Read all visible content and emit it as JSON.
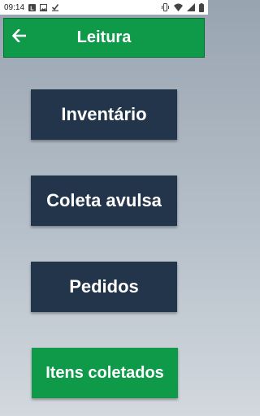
{
  "status_bar": {
    "time": "09:14",
    "left_icons": [
      "notification-l-icon",
      "image-icon",
      "download-done-icon"
    ],
    "right_icons": [
      "vibrate-icon",
      "wifi-icon",
      "signal-icon",
      "battery-icon"
    ]
  },
  "app_bar": {
    "title": "Leitura",
    "back_icon": "arrow-back-icon",
    "color": "#0e9a49"
  },
  "menu": {
    "inventario_label": "Inventário",
    "coleta_label": "Coleta avulsa",
    "pedidos_label": "Pedidos",
    "itens_label": "Itens coletados"
  },
  "colors": {
    "dark_button": "#23354a",
    "green_button": "#0e9a49"
  }
}
